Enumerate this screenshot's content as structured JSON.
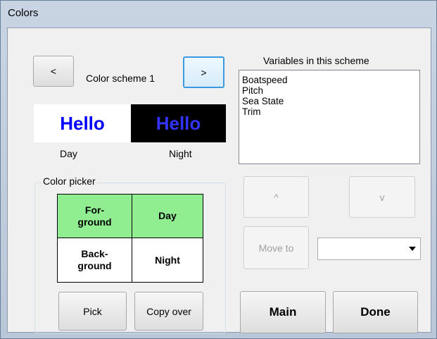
{
  "window": {
    "title": "Colors"
  },
  "scheme": {
    "prev_label": "<",
    "name": "Color scheme 1",
    "next_label": ">"
  },
  "preview": {
    "hello_text": "Hello",
    "day_label": "Day",
    "night_label": "Night",
    "day_bg": "#ffffff",
    "day_fg": "#0000ff",
    "night_bg": "#000000",
    "night_fg": "#3333ff"
  },
  "variables": {
    "label": "Variables in this scheme",
    "items": [
      "Boatspeed",
      "Pitch",
      "Sea State",
      "Trim"
    ]
  },
  "picker": {
    "title": "Color picker",
    "foreground": "For-\nground",
    "day": "Day",
    "background": "Back-\nground",
    "night": "Night",
    "active_color": "#90ee90",
    "pick_label": "Pick",
    "copy_label": "Copy over"
  },
  "order": {
    "up_label": "^",
    "down_label": "v",
    "move_label": "Move to",
    "move_target": ""
  },
  "actions": {
    "main_label": "Main",
    "done_label": "Done"
  },
  "colors": {
    "focus_border": "#3c9be0"
  }
}
